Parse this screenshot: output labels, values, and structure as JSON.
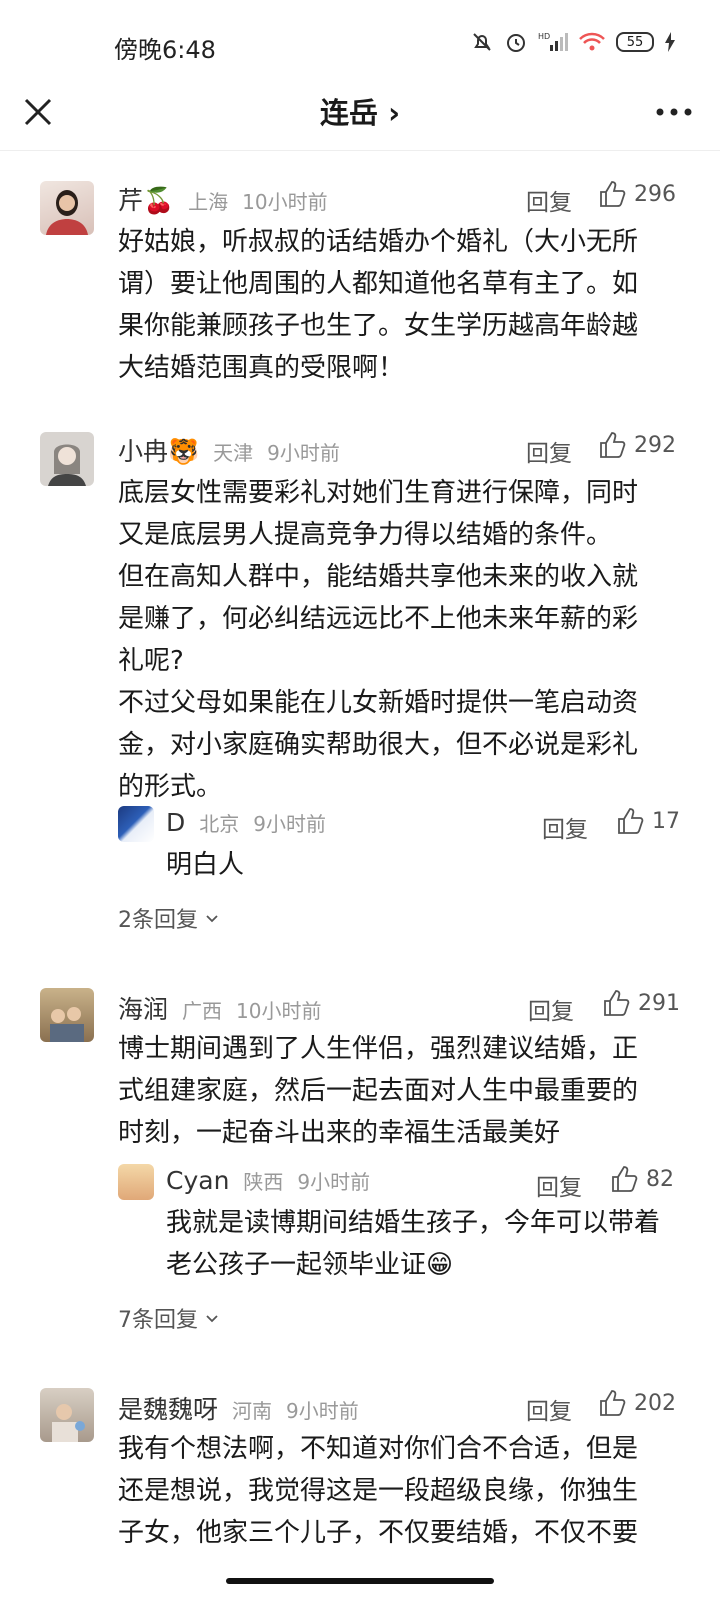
{
  "status_bar": {
    "time": "傍晚6:48",
    "battery": "55"
  },
  "header": {
    "title": "连岳 ›"
  },
  "comments": [
    {
      "name": "芹🍒",
      "location": "上海",
      "time": "10小时前",
      "reply_label": "回复",
      "likes": "296",
      "text": "好姑娘，听叔叔的话结婚办个婚礼（大小无所\n谓）要让他周围的人都知道他名草有主了。如\n果你能兼顾孩子也生了。女生学历越高年龄越\n大结婚范围真的受限啊！"
    },
    {
      "name": "小冉🐯",
      "location": "天津",
      "time": "9小时前",
      "reply_label": "回复",
      "likes": "292",
      "text": "底层女性需要彩礼对她们生育进行保障，同时\n又是底层男人提高竞争力得以结婚的条件。\n但在高知人群中，能结婚共享他未来的收入就\n是赚了，何必纠结远远比不上他未来年薪的彩\n礼呢?\n不过父母如果能在儿女新婚时提供一笔启动资\n金，对小家庭确实帮助很大，但不必说是彩礼\n的形式。",
      "reply": {
        "name": "D",
        "location": "北京",
        "time": "9小时前",
        "reply_label": "回复",
        "likes": "17",
        "text": "明白人"
      },
      "more_replies": "2条回复"
    },
    {
      "name": "海润",
      "location": "广西",
      "time": "10小时前",
      "reply_label": "回复",
      "likes": "291",
      "text": "博士期间遇到了人生伴侣，强烈建议结婚，正\n式组建家庭，然后一起去面对人生中最重要的\n时刻，一起奋斗出来的幸福生活最美好",
      "reply": {
        "name": "Cyan",
        "location": "陕西",
        "time": "9小时前",
        "reply_label": "回复",
        "likes": "82",
        "text": "我就是读博期间结婚生孩子，今年可以带着\n老公孩子一起领毕业证😁"
      },
      "more_replies": "7条回复"
    },
    {
      "name": "是魏魏呀",
      "location": "河南",
      "time": "9小时前",
      "reply_label": "回复",
      "likes": "202",
      "text": "我有个想法啊，不知道对你们合不合适，但是\n还是想说，我觉得这是一段超级良缘，你独生\n子女，他家三个儿子，不仅要结婚，不仅不要"
    }
  ]
}
